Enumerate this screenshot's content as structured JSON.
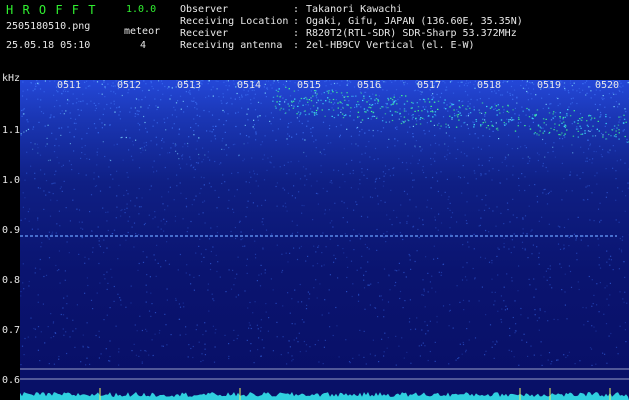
{
  "app": {
    "title": "H R O F F T",
    "version": "1.0.0",
    "filename": "2505180510.png",
    "meteor_label": "meteor",
    "meteor_count": "4",
    "datetime": "25.05.18 05:10"
  },
  "info": {
    "rows": [
      {
        "label": "Observer",
        "sep": ":",
        "value": "Takanori Kawachi"
      },
      {
        "label": "Receiving Location",
        "sep": ":",
        "value": "Ogaki, Gifu, JAPAN (136.60E, 35.35N)"
      },
      {
        "label": "Receiver",
        "sep": ":",
        "value": "R820T2(RTL-SDR) SDR-Sharp 53.372MHz"
      },
      {
        "label": "Receiving antenna",
        "sep": ":",
        "value": "2el-HB9CV Vertical (el. E-W)"
      }
    ]
  },
  "axes": {
    "y_unit": "kHz",
    "y_ticks": [
      "1.1",
      "1.0",
      "0.9",
      "0.8",
      "0.7",
      "0.6"
    ],
    "x_ticks": [
      "0511",
      "0512",
      "0513",
      "0514",
      "0515",
      "0516",
      "0517",
      "0518",
      "0519",
      "0520"
    ]
  },
  "colors": {
    "background": "#000000",
    "spectrum_dark": "#0a0a6e",
    "spectrum_noise": "#1a3cc8",
    "signal_cyan": "#40e0ff",
    "signal_green": "#40ff90",
    "header_green": "#30f030",
    "baseline_cyan": "#30d0e0"
  }
}
